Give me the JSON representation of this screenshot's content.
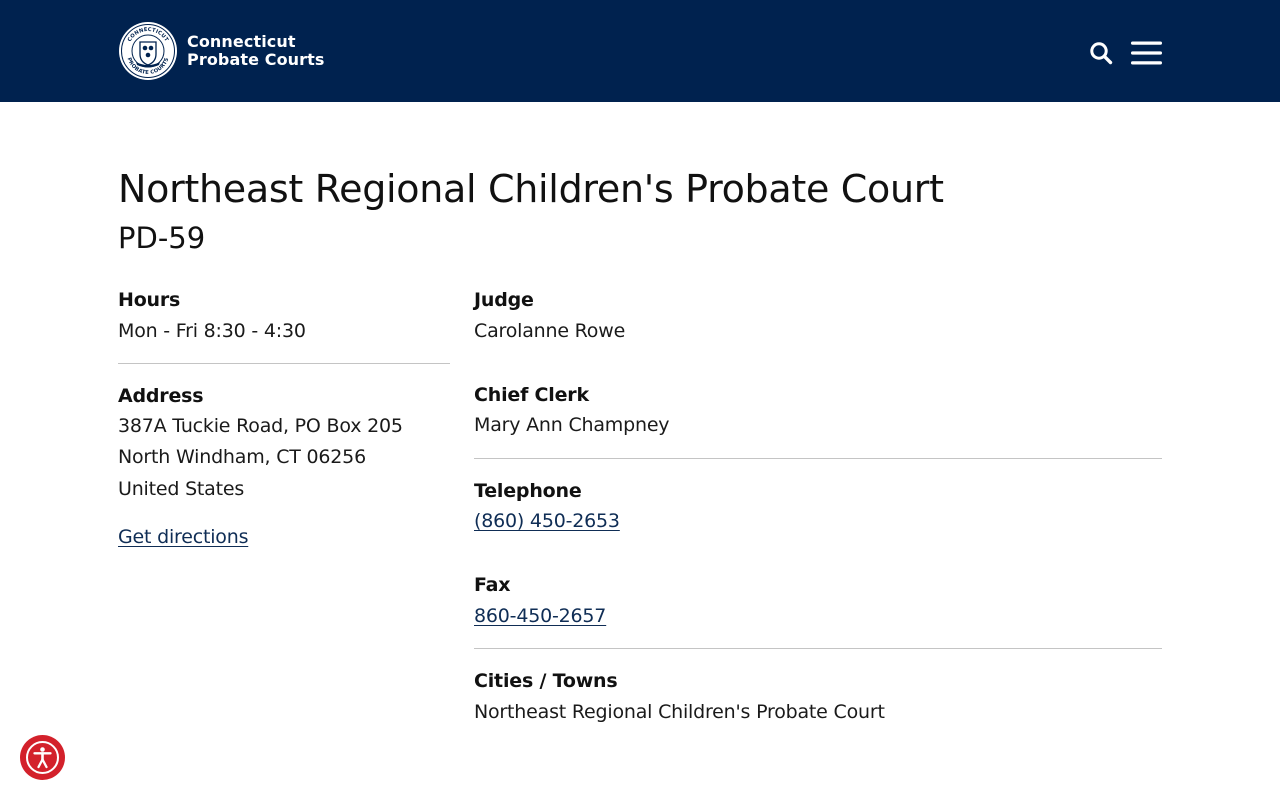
{
  "header": {
    "brand_line1": "Connecticut",
    "brand_line2": "Probate Courts",
    "seal_icon": "connecticut-probate-courts-seal",
    "seal_text_top": "CONNECTICUT",
    "seal_text_bottom": "PROBATE COURTS",
    "search_icon": "search-icon",
    "menu_icon": "hamburger-menu-icon",
    "background_color": "#00224f"
  },
  "court": {
    "name": "Northeast Regional Children's Probate Court",
    "code": "PD-59"
  },
  "hours": {
    "label": "Hours",
    "value": "Mon - Fri 8:30 - 4:30"
  },
  "address": {
    "label": "Address",
    "line1": "387A Tuckie Road, PO Box 205",
    "line2": "North Windham, CT 06256",
    "line3": "United States",
    "directions_label": "Get directions"
  },
  "judge": {
    "label": "Judge",
    "value": "Carolanne Rowe"
  },
  "chief_clerk": {
    "label": "Chief Clerk",
    "value": "Mary Ann Champney"
  },
  "telephone": {
    "label": "Telephone",
    "value": "(860) 450-2653"
  },
  "fax": {
    "label": "Fax",
    "value": "860-450-2657"
  },
  "cities": {
    "label": "Cities / Towns",
    "value": "Northeast Regional Children's Probate Court"
  },
  "accessibility": {
    "icon": "accessibility-icon",
    "color": "#d3212b"
  },
  "colors": {
    "link": "#0f2d55",
    "divider": "#c4c4c4"
  }
}
